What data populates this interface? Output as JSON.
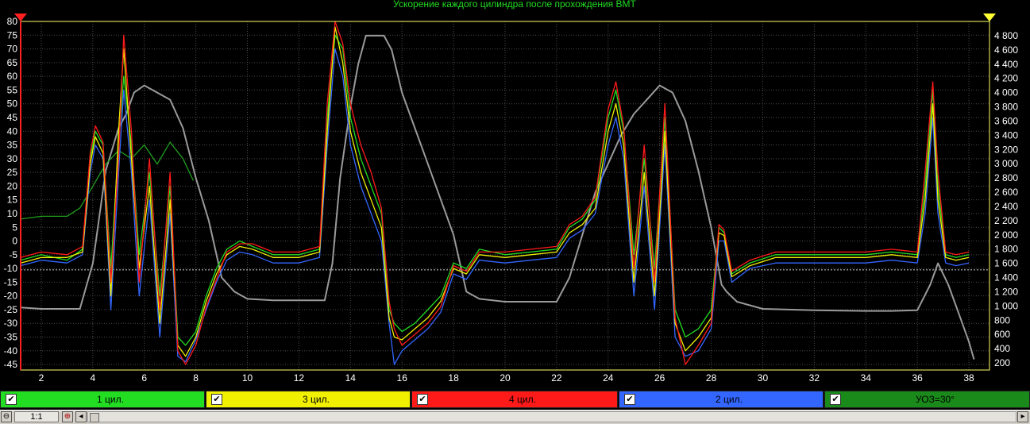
{
  "chart_data": {
    "type": "line",
    "title": "Ускорение каждого цилиндра после прохождения ВМТ",
    "xlim": [
      1.2,
      38.8
    ],
    "x_ticks": [
      2,
      4,
      6,
      8,
      10,
      12,
      14,
      16,
      18,
      20,
      22,
      24,
      26,
      28,
      30,
      32,
      34,
      36,
      38
    ],
    "ylim_left": [
      -47,
      80
    ],
    "y_ticks_left": [
      80,
      75,
      70,
      65,
      60,
      55,
      50,
      45,
      40,
      35,
      30,
      25,
      20,
      15,
      10,
      5,
      0,
      -5,
      -10,
      -15,
      -20,
      -25,
      -30,
      -35,
      -40,
      -45
    ],
    "ylim_right": [
      100,
      5000
    ],
    "y_ticks_right": [
      4800,
      4600,
      4400,
      4200,
      4000,
      3800,
      3600,
      3400,
      3200,
      3000,
      2800,
      2600,
      2400,
      2200,
      2000,
      1800,
      1600,
      1400,
      1200,
      1000,
      800,
      600,
      400,
      200
    ],
    "y_ticks_right_labels": [
      "4 800",
      "4 600",
      "4 400",
      "4 200",
      "4 000",
      "3 800",
      "3 600",
      "3 400",
      "3 200",
      "3 000",
      "2 800",
      "2 600",
      "2 400",
      "2 200",
      "2 000",
      "1 800",
      "1 600",
      "1 400",
      "1 200",
      "1 000",
      "800",
      "600",
      "400",
      "200"
    ],
    "reference_line_y": -10.5,
    "series": [
      {
        "name": "1 цил.",
        "color": "#22dd22",
        "axis": "left",
        "x": [
          1.2,
          2,
          3,
          3.6,
          3.9,
          4.1,
          4.4,
          4.7,
          5,
          5.2,
          5.5,
          5.8,
          6.2,
          6.6,
          7,
          7.3,
          7.6,
          8,
          8.4,
          8.8,
          9.2,
          9.7,
          10.2,
          11,
          12,
          12.8,
          13.1,
          13.4,
          13.7,
          14,
          14.4,
          14.8,
          15.2,
          15.5,
          15.7,
          16,
          16.5,
          17,
          17.5,
          18,
          18.5,
          19,
          20,
          21,
          22,
          22.5,
          23,
          23.5,
          24,
          24.3,
          24.6,
          25,
          25.4,
          25.8,
          26.2,
          26.6,
          27,
          27.5,
          28,
          28.3,
          28.5,
          28.8,
          29.5,
          30.5,
          32,
          34,
          35,
          36,
          36.3,
          36.6,
          36.8,
          37.1,
          37.5,
          38
        ],
        "y": [
          -7,
          -5,
          -7,
          -3,
          30,
          40,
          35,
          -10,
          35,
          60,
          35,
          -5,
          25,
          -20,
          20,
          -35,
          -38,
          -33,
          -20,
          -10,
          -3,
          0,
          -2,
          -5,
          -5,
          -3,
          45,
          75,
          70,
          45,
          30,
          20,
          10,
          -25,
          -30,
          -33,
          -30,
          -25,
          -20,
          -8,
          -10,
          -3,
          -5,
          -4,
          -3,
          5,
          8,
          15,
          45,
          55,
          40,
          -5,
          30,
          -10,
          45,
          -25,
          -35,
          -32,
          -25,
          5,
          3,
          -12,
          -8,
          -5,
          -5,
          -5,
          -4,
          -5,
          20,
          55,
          20,
          -5,
          -6,
          -5
        ]
      },
      {
        "name": "3 цил.",
        "color": "#f0f000",
        "axis": "left",
        "x": [
          1.2,
          2,
          3,
          3.6,
          3.9,
          4.1,
          4.4,
          4.7,
          5,
          5.2,
          5.5,
          5.8,
          6.2,
          6.6,
          7,
          7.3,
          7.6,
          8,
          8.4,
          8.8,
          9.2,
          9.7,
          10.2,
          11,
          12,
          12.8,
          13.1,
          13.4,
          13.7,
          14,
          14.4,
          14.8,
          15.2,
          15.5,
          15.7,
          16,
          16.5,
          17,
          17.5,
          18,
          18.5,
          19,
          20,
          21,
          22,
          22.5,
          23,
          23.5,
          24,
          24.3,
          24.6,
          25,
          25.4,
          25.8,
          26.2,
          26.6,
          27,
          27.5,
          28,
          28.3,
          28.5,
          28.8,
          29.5,
          30.5,
          32,
          34,
          35,
          36,
          36.3,
          36.6,
          36.8,
          37.1,
          37.5,
          38
        ],
        "y": [
          -8,
          -6,
          -6,
          -4,
          28,
          38,
          32,
          -20,
          40,
          70,
          30,
          -10,
          20,
          -30,
          15,
          -38,
          -42,
          -35,
          -22,
          -12,
          -5,
          -2,
          -3,
          -6,
          -6,
          -4,
          40,
          78,
          65,
          40,
          25,
          15,
          5,
          -28,
          -35,
          -36,
          -32,
          -28,
          -22,
          -10,
          -12,
          -5,
          -6,
          -5,
          -4,
          3,
          6,
          12,
          40,
          50,
          35,
          -15,
          25,
          -20,
          40,
          -30,
          -40,
          -35,
          -28,
          3,
          2,
          -13,
          -9,
          -6,
          -6,
          -6,
          -5,
          -6,
          15,
          50,
          15,
          -6,
          -7,
          -6
        ]
      },
      {
        "name": "4 цил.",
        "color": "#ff1a1a",
        "axis": "left",
        "x": [
          1.2,
          2,
          3,
          3.6,
          3.9,
          4.1,
          4.4,
          4.7,
          5,
          5.2,
          5.5,
          5.8,
          6.2,
          6.6,
          7,
          7.3,
          7.6,
          8,
          8.4,
          8.8,
          9.2,
          9.7,
          10.2,
          11,
          12,
          12.8,
          13.1,
          13.4,
          13.7,
          14,
          14.4,
          14.8,
          15.2,
          15.5,
          15.7,
          16,
          16.5,
          17,
          17.5,
          18,
          18.5,
          19,
          20,
          21,
          22,
          22.5,
          23,
          23.5,
          24,
          24.3,
          24.6,
          25,
          25.4,
          25.8,
          26.2,
          26.6,
          27,
          27.5,
          28,
          28.3,
          28.5,
          28.8,
          29.5,
          30.5,
          32,
          34,
          35,
          36,
          36.3,
          36.6,
          36.8,
          37.1,
          37.5,
          38
        ],
        "y": [
          -6,
          -4,
          -5,
          -2,
          32,
          42,
          36,
          -15,
          30,
          75,
          40,
          -15,
          30,
          -25,
          25,
          -40,
          -45,
          -38,
          -24,
          -14,
          -4,
          -1,
          -1,
          -4,
          -4,
          -2,
          50,
          80,
          72,
          50,
          35,
          25,
          12,
          -22,
          -32,
          -38,
          -34,
          -30,
          -24,
          -9,
          -11,
          -4,
          -4,
          -3,
          -2,
          6,
          9,
          16,
          48,
          58,
          42,
          -10,
          35,
          -15,
          50,
          -28,
          -45,
          -38,
          -30,
          6,
          4,
          -11,
          -7,
          -4,
          -4,
          -4,
          -3,
          -4,
          25,
          58,
          25,
          -4,
          -5,
          -4
        ]
      },
      {
        "name": "2 цил.",
        "color": "#3366ff",
        "axis": "left",
        "x": [
          1.2,
          2,
          3,
          3.6,
          3.9,
          4.1,
          4.4,
          4.7,
          5,
          5.2,
          5.5,
          5.8,
          6.2,
          6.6,
          7,
          7.3,
          7.6,
          8,
          8.4,
          8.8,
          9.2,
          9.7,
          10.2,
          11,
          12,
          12.8,
          13.1,
          13.4,
          13.7,
          14,
          14.4,
          14.8,
          15.2,
          15.5,
          15.7,
          16,
          16.5,
          17,
          17.5,
          18,
          18.5,
          19,
          20,
          21,
          22,
          22.5,
          23,
          23.5,
          24,
          24.3,
          24.6,
          25,
          25.4,
          25.8,
          26.2,
          26.6,
          27,
          27.5,
          28,
          28.3,
          28.5,
          28.8,
          29.5,
          30.5,
          32,
          34,
          35,
          36,
          36.3,
          36.6,
          36.8,
          37.1,
          37.5,
          38
        ],
        "y": [
          -9,
          -7,
          -8,
          -5,
          25,
          35,
          30,
          -25,
          25,
          55,
          25,
          -20,
          15,
          -35,
          10,
          -42,
          -44,
          -36,
          -25,
          -15,
          -7,
          -4,
          -5,
          -8,
          -8,
          -6,
          35,
          70,
          60,
          35,
          20,
          10,
          0,
          -30,
          -45,
          -40,
          -36,
          -32,
          -26,
          -12,
          -14,
          -7,
          -8,
          -7,
          -6,
          1,
          4,
          10,
          35,
          45,
          30,
          -20,
          20,
          -25,
          35,
          -35,
          -42,
          -40,
          -32,
          0,
          0,
          -15,
          -10,
          -8,
          -8,
          -8,
          -7,
          -8,
          10,
          45,
          10,
          -8,
          -9,
          -8
        ]
      },
      {
        "name": "УОЗ=30°",
        "color": "#1f9f1f",
        "axis": "left",
        "x": [
          1.2,
          2,
          3,
          3.5,
          4,
          4.5,
          5,
          5.5,
          6,
          6.5,
          7,
          7.5,
          7.9
        ],
        "y": [
          8,
          9,
          9,
          12,
          20,
          28,
          33,
          30,
          35,
          28,
          36,
          30,
          22
        ]
      },
      {
        "name": "",
        "color": "#9a9a9a",
        "axis": "right",
        "x": [
          1.2,
          2,
          3.5,
          4,
          4.5,
          5,
          5.3,
          5.6,
          6,
          6.5,
          7,
          7.5,
          8,
          8.5,
          9,
          9.5,
          10,
          11,
          12,
          13,
          13.3,
          13.6,
          14,
          14.3,
          14.6,
          15,
          15.3,
          15.6,
          16,
          17,
          18,
          18.5,
          19,
          20,
          21,
          22,
          22.5,
          23,
          23.5,
          24,
          24.5,
          25,
          25.5,
          26,
          26.5,
          27,
          27.5,
          28,
          28.4,
          28.6,
          29,
          30,
          32,
          34,
          35,
          36,
          36.5,
          36.8,
          37.2,
          37.6,
          38,
          38.2
        ],
        "y": [
          980,
          960,
          960,
          1600,
          2900,
          3500,
          3700,
          4000,
          4100,
          4000,
          3900,
          3500,
          2800,
          2200,
          1400,
          1200,
          1100,
          1080,
          1080,
          1080,
          1600,
          2800,
          3800,
          4400,
          4800,
          4800,
          4800,
          4600,
          4000,
          3000,
          2000,
          1200,
          1100,
          1060,
          1060,
          1060,
          1400,
          2000,
          2600,
          3000,
          3400,
          3700,
          3900,
          4100,
          4000,
          3600,
          2900,
          2100,
          1300,
          1200,
          1060,
          960,
          940,
          930,
          930,
          940,
          1300,
          1600,
          1300,
          900,
          500,
          250
        ]
      }
    ]
  },
  "legend": [
    {
      "label": "1 цил.",
      "bg": "#22dd22",
      "fg": "#000000"
    },
    {
      "label": "3 цил.",
      "bg": "#f0f000",
      "fg": "#000000"
    },
    {
      "label": "4 цил.",
      "bg": "#ff1a1a",
      "fg": "#000000"
    },
    {
      "label": "2 цил.",
      "bg": "#3366ff",
      "fg": "#000000"
    },
    {
      "label": "УОЗ=30°",
      "bg": "#1a8a1a",
      "fg": "#000000"
    }
  ],
  "status": {
    "zoom": "1:1"
  },
  "colors": {
    "title": "#22dd22",
    "axis_text": "#ffffff",
    "grid": "#555555",
    "frame": "#ffff66"
  }
}
